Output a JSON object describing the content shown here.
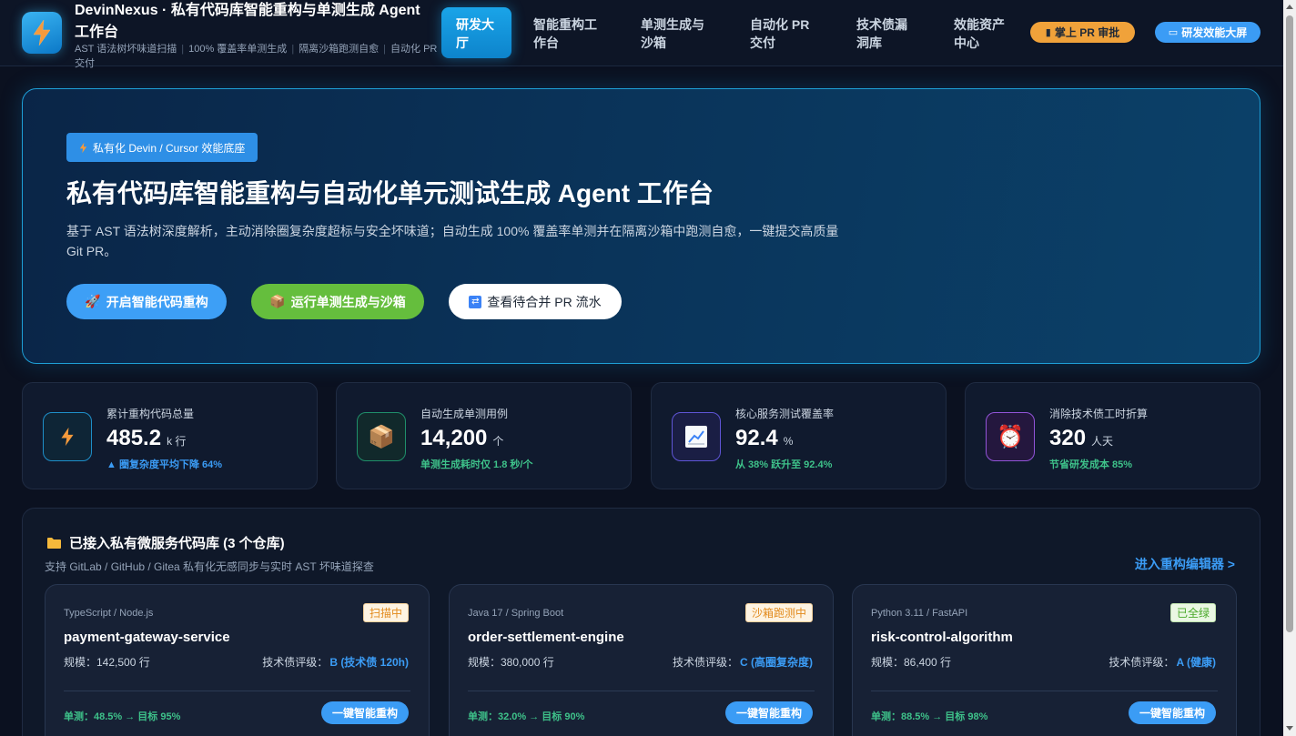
{
  "header": {
    "brand_title": "DevinNexus · 私有代码库智能重构与单测生成 Agent 工作台",
    "brand_sub": [
      "AST 语法树坏味道扫描",
      "100% 覆盖率单测生成",
      "隔离沙箱跑测自愈",
      "自动化 PR 交付"
    ],
    "nav": [
      {
        "label": "研发大厅",
        "active": true
      },
      {
        "label": "智能重构工作台",
        "active": false
      },
      {
        "label": "单测生成与沙箱",
        "active": false
      },
      {
        "label": "自动化 PR 交付",
        "active": false
      },
      {
        "label": "技术债漏洞库",
        "active": false
      },
      {
        "label": "效能资产中心",
        "active": false
      }
    ],
    "pill_review": "掌上 PR 审批",
    "pill_dashboard": "研发效能大屏"
  },
  "hero": {
    "tag": "私有化 Devin / Cursor 效能底座",
    "title": "私有代码库智能重构与自动化单元测试生成 Agent 工作台",
    "desc": "基于 AST 语法树深度解析，主动消除圈复杂度超标与安全坏味道；自动生成 100% 覆盖率单测并在隔离沙箱中跑测自愈，一键提交高质量 Git PR。",
    "btn_refactor": "开启智能代码重构",
    "btn_test": "运行单测生成与沙箱",
    "btn_pr": "查看待合并 PR 流水"
  },
  "stats": [
    {
      "label": "累计重构代码总量",
      "value": "485.2",
      "unit": "k 行",
      "note": "▲ 圈复杂度平均下降 64%",
      "icon": "lightning-icon",
      "note_color": "#3b9cf5"
    },
    {
      "label": "自动生成单测用例",
      "value": "14,200",
      "unit": "个",
      "note": "单测生成耗时仅 1.8 秒/个",
      "icon": "package-icon",
      "note_color": "#3ec28a"
    },
    {
      "label": "核心服务测试覆盖率",
      "value": "92.4",
      "unit": "%",
      "note": "从 38% 跃升至 92.4%",
      "icon": "chart-up-icon",
      "note_color": "#3ec28a"
    },
    {
      "label": "消除技术债工时折算",
      "value": "320",
      "unit": "人天",
      "note": "节省研发成本 85%",
      "icon": "alarm-clock-icon",
      "note_color": "#3ec28a"
    }
  ],
  "repos_panel": {
    "title": "已接入私有微服务代码库 (3 个仓库)",
    "sub": "支持 GitLab / GitHub / Gitea 私有化无感同步与实时 AST 坏味道探查",
    "link": "进入重构编辑器 >",
    "repos": [
      {
        "lang": "TypeScript / Node.js",
        "status": "扫描中",
        "name": "payment-gateway-service",
        "scale": "规模：142,500 行",
        "debt_label": "技术债评级：",
        "debt_value": "B (技术债 120h)",
        "test": "单测：48.5% → 目标 95%",
        "btn": "一键智能重构"
      },
      {
        "lang": "Java 17 / Spring Boot",
        "status": "沙箱跑测中",
        "name": "order-settlement-engine",
        "scale": "规模：380,000 行",
        "debt_label": "技术债评级：",
        "debt_value": "C (高圈复杂度)",
        "test": "单测：32.0% → 目标 90%",
        "btn": "一键智能重构"
      },
      {
        "lang": "Python 3.11 / FastAPI",
        "status": "已全绿",
        "name": "risk-control-algorithm",
        "scale": "规模：86,400 行",
        "debt_label": "技术债评级：",
        "debt_value": "A (健康)",
        "test": "单测：88.5% → 目标 98%",
        "btn": "一键智能重构"
      }
    ]
  }
}
